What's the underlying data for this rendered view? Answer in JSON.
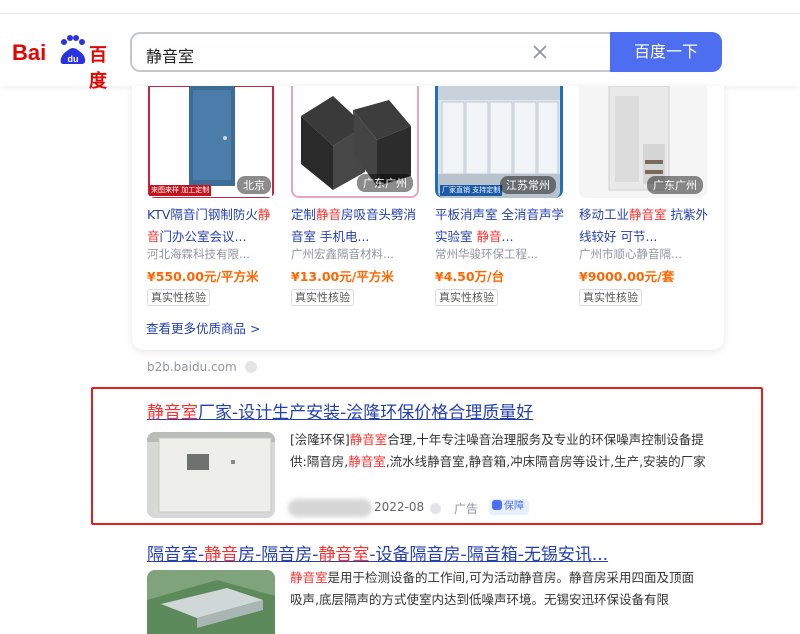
{
  "header": {
    "logo_text_latin": "Bai",
    "logo_text_du": "du",
    "logo_text_cn": "百度",
    "search_value": "静音室",
    "search_button": "百度一下"
  },
  "products": [
    {
      "title_a": "KTV隔音门钢制防火",
      "title_hl": "静音",
      "title_b": "门办公室会议...",
      "company": "河北海霖科技有限...",
      "price": "¥550.00元/平方米",
      "location": "北京",
      "badge": "来图来样 加工定制",
      "verify": "真实性核验"
    },
    {
      "title_a": "定制",
      "title_hl": "静音",
      "title_b": "房吸音头劈消音室 手机电...",
      "company": "广州宏鑫隔音材料...",
      "price": "¥13.00元/平方米",
      "location": "广东广州",
      "badge": "",
      "verify": "真实性核验"
    },
    {
      "title_a": "平板消声室 全消音声学实验室 ",
      "title_hl": "静音",
      "title_b": "...",
      "company": "常州华骏环保工程...",
      "price": "¥4.50万/台",
      "location": "江苏常州",
      "badge": "厂家直销 支持定制",
      "verify": "真实性核验"
    },
    {
      "title_a": "移动工业",
      "title_hl": "静音室",
      "title_b": " 抗紫外线较好 可节...",
      "company": "广州市顺心静音隔...",
      "price": "¥9000.00元/套",
      "location": "广东广州",
      "badge": "",
      "verify": "真实性核验"
    }
  ],
  "more_link": "查看更多优质商品 >",
  "source": "b2b.baidu.com",
  "ad_result": {
    "title_hl": "静音室",
    "title_rest": "厂家-设计生产安装-浍隆环保价格合理质量好",
    "desc_1": "[浍隆环保]",
    "desc_hl_1": "静音室",
    "desc_2": "合理,十年专注噪音治理服务及专业的环保噪声控制设备提供:隔音房,",
    "desc_hl_2": "静音室",
    "desc_3": ",流水线静音室,静音箱,冲床隔音房等设计,生产,安装的厂家",
    "date": "2022-08",
    "ad_label": "广告",
    "guarantee": "保障"
  },
  "result_2": {
    "t1": "隔音室-",
    "t_hl1": "静音",
    "t2": "房-隔音房-",
    "t_hl2": "静音室",
    "t3": "-设备隔音房-隔音箱-无锡安讯...",
    "desc_hl": "静音室",
    "desc": "是用于检测设备的工作间,可为活动静音房。静音房采用四面及顶面吸声,底层隔声的方式使室内达到低噪声环境。无锡安迅环保设备有限"
  },
  "colors": {
    "link": "#2440b3",
    "highlight": "#f73131",
    "price": "#ff6600",
    "brand_blue": "#4e6ef2",
    "ad_border": "#e02020"
  }
}
